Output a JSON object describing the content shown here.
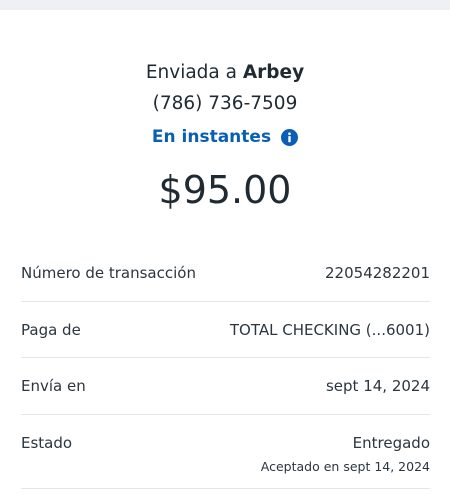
{
  "top_strip_color": "#eef0f3",
  "accent_color": "#0a5fb4",
  "summary": {
    "sent_prefix": "Enviada a",
    "recipient_name": "Arbey",
    "phone": "(786) 736-7509",
    "speed_label": "En instantes",
    "info_icon": "info-icon",
    "amount": "$95.00"
  },
  "details": [
    {
      "label": "Número de transacción",
      "value": "22054282201"
    },
    {
      "label": "Paga de",
      "value": "TOTAL CHECKING (...6001)"
    },
    {
      "label": "Envía en",
      "value": "sept 14, 2024"
    },
    {
      "label": "Estado",
      "value": "Entregado",
      "sub": "Aceptado en sept 14, 2024"
    }
  ]
}
